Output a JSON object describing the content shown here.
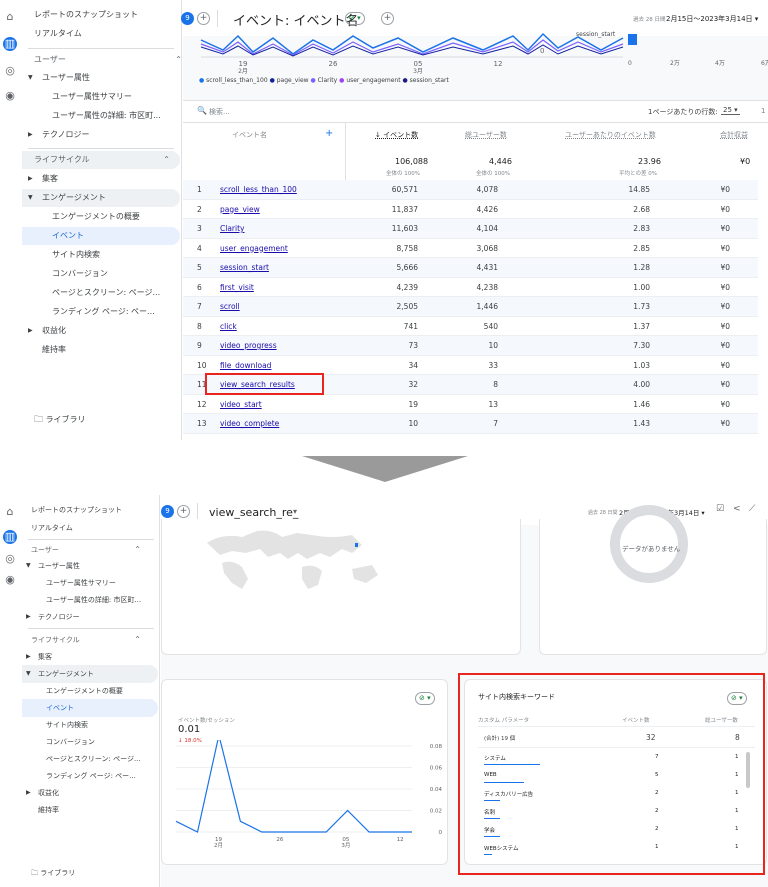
{
  "sidebar": {
    "snapshot": "レポートのスナップショット",
    "realtime": "リアルタイム",
    "user_section": "ユーザー",
    "user_attr": "ユーザー属性",
    "user_attr_summary": "ユーザー属性サマリー",
    "user_attr_detail": "ユーザー属性の詳細: 市区町...",
    "technology": "テクノロジー",
    "lifecycle": "ライフサイクル",
    "acquisition": "集客",
    "engagement": "エンゲージメント",
    "engagement_overview": "エンゲージメントの概要",
    "events": "イベント",
    "site_search": "サイト内検索",
    "conversions": "コンバージョン",
    "pages_screens": "ページとスクリーン: ページ...",
    "landing_page": "ランディング ページ: ペー...",
    "monetization": "収益化",
    "retention": "維持率",
    "library": "ライブラリ"
  },
  "top": {
    "badge": "9",
    "title1": "イベント: イベント名",
    "title2": "view_search_re_",
    "date_small": "過去 28 日間",
    "date_range": "2月15日～2023年3月14日"
  },
  "chart1": {
    "x_labels": [
      "19\n2月",
      "26",
      "05\n3月",
      "12"
    ],
    "legend": [
      "scroll_less_than_100",
      "page_view",
      "Clarity",
      "user_engagement",
      "session_start"
    ],
    "legend_colors": [
      "#1a73e8",
      "#12239e",
      "#7b61ff",
      "#a142f4",
      "#1a1a80"
    ],
    "right_label": "session_start",
    "right_axis": [
      "0",
      "2万",
      "4万",
      "6万"
    ],
    "zero": "0"
  },
  "table": {
    "search_placeholder": "検索...",
    "rows_per_page_label": "1ページあたりの行数:",
    "rows_per_page": "25",
    "page_hint": "1",
    "col_name": "イベント名",
    "col_events": "↓ イベント数",
    "col_users": "総ユーザー数",
    "col_per_user": "ユーザーあたりのイベント数",
    "col_revenue": "合計収益",
    "tot_events": "106,088",
    "tot_events_sub": "全体の 100%",
    "tot_users": "4,446",
    "tot_users_sub": "全体の 100%",
    "tot_per_user": "23.96",
    "tot_per_user_sub": "平均との差 0%",
    "tot_revenue": "¥0",
    "rows": [
      [
        "1",
        "scroll_less_than_100",
        "60,571",
        "4,078",
        "14.85",
        "¥0"
      ],
      [
        "2",
        "page_view",
        "11,837",
        "4,426",
        "2.68",
        "¥0"
      ],
      [
        "3",
        "Clarity",
        "11,603",
        "4,104",
        "2.83",
        "¥0"
      ],
      [
        "4",
        "user_engagement",
        "8,758",
        "3,068",
        "2.85",
        "¥0"
      ],
      [
        "5",
        "session_start",
        "5,666",
        "4,431",
        "1.28",
        "¥0"
      ],
      [
        "6",
        "first_visit",
        "4,239",
        "4,238",
        "1.00",
        "¥0"
      ],
      [
        "7",
        "scroll",
        "2,505",
        "1,446",
        "1.73",
        "¥0"
      ],
      [
        "8",
        "click",
        "741",
        "540",
        "1.37",
        "¥0"
      ],
      [
        "9",
        "video_progress",
        "73",
        "10",
        "7.30",
        "¥0"
      ],
      [
        "10",
        "file_download",
        "34",
        "33",
        "1.03",
        "¥0"
      ],
      [
        "11",
        "view_search_results",
        "32",
        "8",
        "4.00",
        "¥0"
      ],
      [
        "12",
        "video_start",
        "19",
        "13",
        "1.46",
        "¥0"
      ],
      [
        "13",
        "video_complete",
        "10",
        "7",
        "1.43",
        "¥0"
      ]
    ]
  },
  "panel2": {
    "no_data": "データがありません",
    "metric_label": "イベント数/セッション",
    "metric_value": "0.01",
    "metric_change": "↓ 18.0%",
    "y_ticks": [
      "0.08",
      "0.06",
      "0.04",
      "0.02",
      "0"
    ],
    "x_ticks": [
      "19\n2月",
      "26",
      "05\n3月",
      "12"
    ],
    "kw_title": "サイト内検索キーワード",
    "kw_col_param": "カスタム パラメータ",
    "kw_col_events": "イベント数",
    "kw_col_users": "総ユーザー数",
    "kw_total_label": "(合計) 19 個",
    "kw_total_events": "32",
    "kw_total_users": "8",
    "kw_rows": [
      [
        "システム",
        "7",
        "1"
      ],
      [
        "WEB",
        "5",
        "1"
      ],
      [
        "ディスカバリー広告",
        "2",
        "1"
      ],
      [
        "名刺",
        "2",
        "1"
      ],
      [
        "学会",
        "2",
        "1"
      ],
      [
        "WEBシステム",
        "1",
        "1"
      ]
    ]
  },
  "chart_data": {
    "type": "line",
    "x": [
      "19 2月",
      "26",
      "05 3月",
      "12"
    ],
    "series": [
      {
        "name": "イベント数/セッション",
        "values": [
          0.01,
          0.0,
          0.09,
          0.01,
          0.0,
          0.0,
          0.0,
          0.0,
          0.02,
          0.0,
          0.0,
          0.0
        ]
      }
    ],
    "ylim": [
      0,
      0.08
    ]
  }
}
